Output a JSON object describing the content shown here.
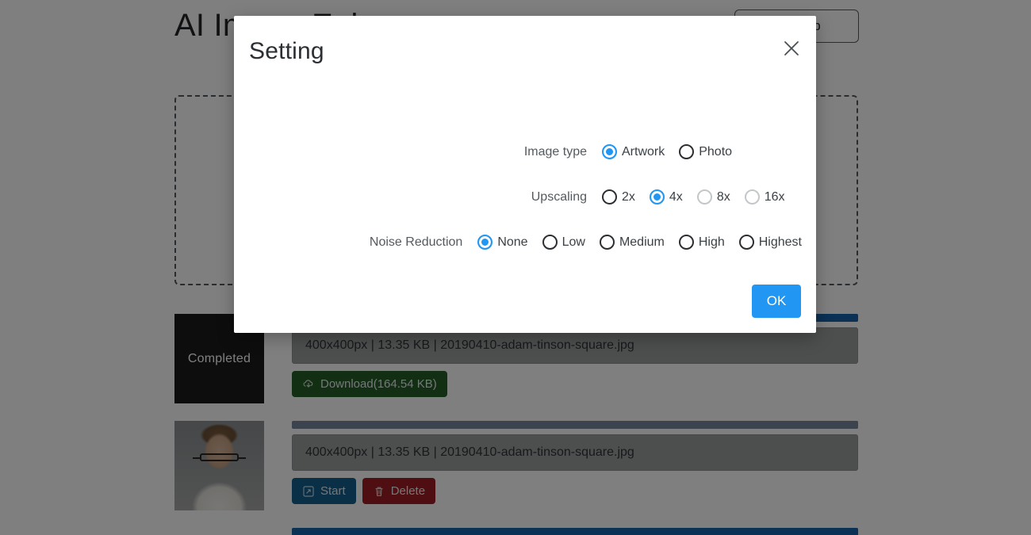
{
  "background": {
    "page_title": "AI Image Enhancer",
    "signup_label": "Sign Up",
    "dropzone_label": "",
    "rows": [
      {
        "status_label": "Completed",
        "progress_percent": 100,
        "file_info": "400x400px | 13.35 KB | 20190410-adam-tinson-square.jpg",
        "actions": [
          {
            "label": "Download(164.54 KB)",
            "icon": "cloud-download-icon",
            "color": "#255c27"
          }
        ]
      },
      {
        "status_label": "",
        "progress_percent": 100,
        "file_info": "400x400px | 13.35 KB | 20190410-adam-tinson-square.jpg",
        "actions": [
          {
            "label": "Start",
            "icon": "expand-icon",
            "color": "#14618f"
          },
          {
            "label": "Delete",
            "icon": "trash-icon",
            "color": "#9e1c22"
          }
        ]
      }
    ]
  },
  "modal": {
    "title": "Setting",
    "close_icon": "close-icon",
    "ok_label": "OK",
    "settings": [
      {
        "label": "Image type",
        "name": "image-type",
        "options": [
          {
            "label": "Artwork",
            "selected": true,
            "disabled": false
          },
          {
            "label": "Photo",
            "selected": false,
            "disabled": false
          }
        ]
      },
      {
        "label": "Upscaling",
        "name": "upscaling",
        "options": [
          {
            "label": "2x",
            "selected": false,
            "disabled": false
          },
          {
            "label": "4x",
            "selected": true,
            "disabled": false
          },
          {
            "label": "8x",
            "selected": false,
            "disabled": true
          },
          {
            "label": "16x",
            "selected": false,
            "disabled": true
          }
        ]
      },
      {
        "label": "Noise Reduction",
        "name": "noise-reduction",
        "options": [
          {
            "label": "None",
            "selected": true,
            "disabled": false
          },
          {
            "label": "Low",
            "selected": false,
            "disabled": false
          },
          {
            "label": "Medium",
            "selected": false,
            "disabled": false
          },
          {
            "label": "High",
            "selected": false,
            "disabled": false
          },
          {
            "label": "Highest",
            "selected": false,
            "disabled": false
          }
        ]
      }
    ]
  },
  "colors": {
    "accent_blue": "#2196f3",
    "download_green": "#255c27",
    "start_blue": "#14618f",
    "delete_red": "#9e1c22",
    "overlay": "rgba(0,0,0,0.5)"
  }
}
